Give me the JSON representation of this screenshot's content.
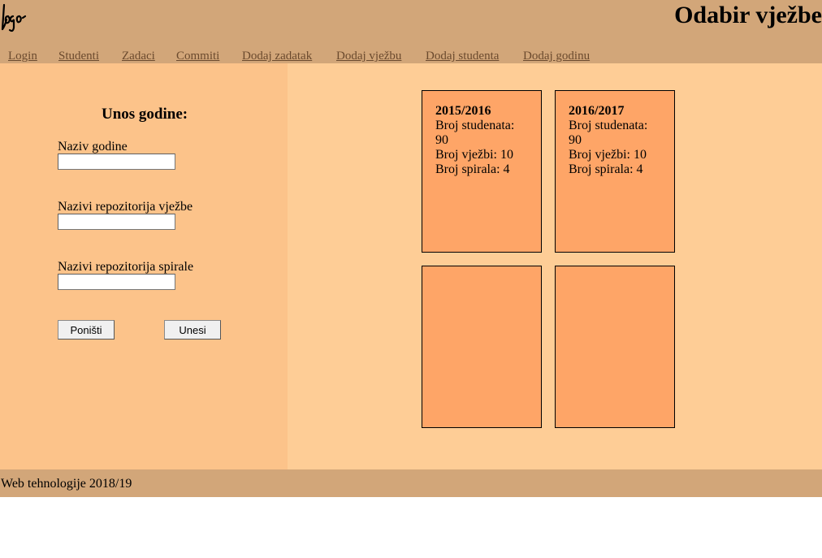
{
  "header": {
    "logo_text": "logo",
    "title": "Odabir vježbe"
  },
  "nav": {
    "items": [
      {
        "label": "Login"
      },
      {
        "label": "Studenti"
      },
      {
        "label": "Zadaci"
      },
      {
        "label": "Commiti"
      },
      {
        "label": "Dodaj zadatak"
      },
      {
        "label": "Dodaj vježbu"
      },
      {
        "label": "Dodaj studenta"
      },
      {
        "label": "Dodaj godinu"
      }
    ]
  },
  "form": {
    "title": "Unos godine:",
    "fields": [
      {
        "label": "Naziv godine",
        "value": ""
      },
      {
        "label": "Nazivi repozitorija vježbe",
        "value": ""
      },
      {
        "label": "Nazivi repozitorija spirale",
        "value": ""
      }
    ],
    "reset_label": "Poništi",
    "submit_label": "Unesi"
  },
  "years": {
    "cards": [
      {
        "name": "2015/2016",
        "students": "Broj studenata: 90",
        "exercises": "Broj vježbi: 10",
        "spirals": "Broj spirala: 4"
      },
      {
        "name": "2016/2017",
        "students": "Broj studenata: 90",
        "exercises": "Broj vježbi: 10",
        "spirals": "Broj spirala: 4"
      }
    ]
  },
  "footer": {
    "text": "Web tehnologije 2018/19"
  },
  "colors": {
    "header_footer_bg": "#d2a679",
    "left_panel_bg": "#fcc38a",
    "right_panel_bg": "#fecd96",
    "card_bg": "#fea567",
    "nav_link": "#6b4a2e"
  }
}
